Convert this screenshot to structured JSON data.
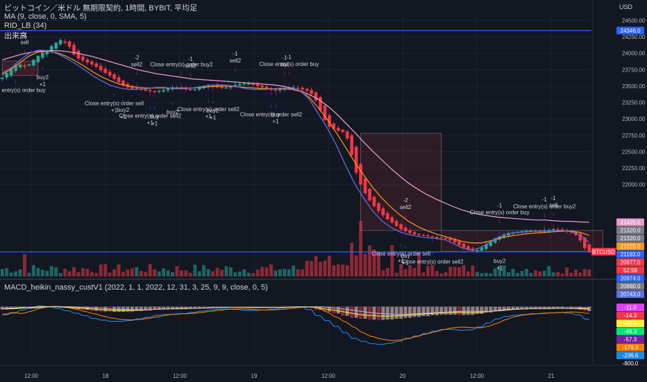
{
  "header": {
    "title": "ビットコイン／米ドル 無期限契約, 1時間, BYBIT, 平均足",
    "ma": "MA (9, close, 0, SMA, 5)",
    "rid": "RID_LB (34)",
    "volume": "出来高",
    "macd": "MACD_heikin_nassy_custV1 (2022, 1, 1, 2022, 12, 31, 3, 25, 9, 9, close, 0, 5)",
    "currency": "USD"
  },
  "colors": {
    "up": "#26a69a",
    "down": "#f23645",
    "ma_fast": "#5b6ee1",
    "ma_mid": "#f7931a",
    "ma_slow": "#e39ac9",
    "hline": "#2962ff",
    "buy": "#2962ff",
    "sell": "#f23645",
    "close": "#d500f9"
  },
  "chart_data": [
    {
      "type": "candlestick",
      "name": "price",
      "ylim": [
        20600,
        24600
      ],
      "y_ticks": [
        24500,
        24250,
        24000,
        23750,
        23500,
        23250,
        23000,
        22750,
        22500,
        22250,
        22000
      ],
      "x_ticks": [
        "12:00",
        "18",
        "12:00",
        "19",
        "12:00",
        "20",
        "12:00",
        "21"
      ],
      "hlines": [
        24346,
        20974
      ],
      "price_tags": [
        {
          "label": "24346.0",
          "value": 24346,
          "color": "#2962ff"
        },
        {
          "label": "21425.5",
          "value": 21425.5,
          "color": "#e39ac9"
        },
        {
          "label": "21320.0",
          "value": 21320,
          "color": "#787b86"
        },
        {
          "label": "21320.0",
          "value": 21320,
          "color": "#787b86"
        },
        {
          "label": "21225.0",
          "value": 21225,
          "color": "#f7931a"
        },
        {
          "label": "21193.0",
          "value": 21193,
          "color": "#2962ff"
        },
        {
          "label": "BTCUSD",
          "value": 20977,
          "color": "#f23645"
        },
        {
          "label": "20977.0",
          "value": 20977,
          "color": "#f23645"
        },
        {
          "label": "52:59",
          "value": 20977,
          "color": "#f23645"
        },
        {
          "label": "20974.0",
          "value": 20974,
          "color": "#2962ff"
        },
        {
          "label": "20880.0",
          "value": 20880,
          "color": "#787b86"
        },
        {
          "label": "20743.0",
          "value": 20743,
          "color": "#5b6ee1"
        }
      ],
      "close": [
        23630,
        23700,
        23760,
        23810,
        23830,
        23800,
        23830,
        23900,
        23960,
        24010,
        24030,
        24110,
        24160,
        24200,
        24160,
        24100,
        23980,
        23920,
        23890,
        23860,
        23830,
        23790,
        23740,
        23700,
        23660,
        23610,
        23560,
        23510,
        23480,
        23460,
        23460,
        23450,
        23430,
        23420,
        23410,
        23430,
        23440,
        23460,
        23480,
        23470,
        23460,
        23450,
        23440,
        23450,
        23480,
        23500,
        23520,
        23500,
        23480,
        23470,
        23480,
        23500,
        23520,
        23530,
        23540,
        23540,
        23520,
        23500,
        23480,
        23460,
        23440,
        23440,
        23450,
        23460,
        23470,
        23480,
        23470,
        23450,
        23430,
        23380,
        23280,
        23130,
        22980,
        22880,
        22850,
        22820,
        22800,
        22700,
        22450,
        22180,
        22000,
        21870,
        21760,
        21670,
        21600,
        21530,
        21470,
        21420,
        21370,
        21320,
        21290,
        21260,
        21240,
        21230,
        21220,
        21210,
        21200,
        21190,
        21180,
        21170,
        21150,
        21120,
        21080,
        21040,
        21010,
        20990,
        21000,
        21040,
        21090,
        21140,
        21180,
        21210,
        21240,
        21260,
        21270,
        21280,
        21290,
        21300,
        21300,
        21290,
        21280,
        21300,
        21310,
        21320,
        21310,
        21300,
        21290,
        21270,
        21230,
        21150,
        21030,
        20977
      ],
      "indicators": {
        "ma_fast": [
          23700,
          23780,
          23900,
          24000,
          24050,
          24040,
          24000,
          23930,
          23850,
          23760,
          23660,
          23580,
          23510,
          23470,
          23450,
          23450,
          23460,
          23480,
          23480,
          23460,
          23460,
          23470,
          23490,
          23510,
          23520,
          23510,
          23490,
          23460,
          23450,
          23450,
          23460,
          23470,
          23460,
          23430,
          23300,
          23080,
          22860,
          22600,
          22300,
          22020,
          21800,
          21600,
          21450,
          21350,
          21280,
          21240,
          21210,
          21190,
          21180,
          21160,
          21100,
          21030,
          21000,
          21040,
          21120,
          21200,
          21250,
          21270,
          21280,
          21290,
          21290,
          21300,
          21300,
          21280,
          21230,
          21120
        ],
        "ma_mid": [
          23680,
          23760,
          23860,
          23960,
          24020,
          24030,
          24010,
          23960,
          23890,
          23810,
          23720,
          23640,
          23580,
          23530,
          23500,
          23480,
          23470,
          23470,
          23470,
          23470,
          23470,
          23470,
          23480,
          23490,
          23500,
          23500,
          23490,
          23480,
          23470,
          23460,
          23460,
          23460,
          23450,
          23420,
          23330,
          23170,
          22990,
          22790,
          22570,
          22350,
          22150,
          21960,
          21800,
          21660,
          21540,
          21440,
          21360,
          21300,
          21250,
          21210,
          21170,
          21130,
          21110,
          21110,
          21140,
          21180,
          21210,
          21230,
          21250,
          21260,
          21270,
          21280,
          21290,
          21290,
          21270,
          21225
        ],
        "ma_slow": [
          23900,
          23940,
          23980,
          24010,
          24030,
          24040,
          24040,
          24030,
          24010,
          23980,
          23950,
          23910,
          23870,
          23830,
          23790,
          23750,
          23720,
          23690,
          23670,
          23650,
          23630,
          23610,
          23600,
          23590,
          23580,
          23570,
          23560,
          23550,
          23540,
          23530,
          23520,
          23500,
          23470,
          23430,
          23370,
          23300,
          23200,
          23080,
          22940,
          22800,
          22650,
          22510,
          22380,
          22250,
          22130,
          22020,
          21930,
          21850,
          21780,
          21720,
          21660,
          21610,
          21570,
          21540,
          21520,
          21500,
          21490,
          21480,
          21470,
          21460,
          21460,
          21450,
          21440,
          21440,
          21430,
          21425
        ]
      },
      "signals": [
        {
          "i": 3,
          "side": "buy",
          "lines": [
            "Close entry(s) order buy"
          ]
        },
        {
          "i": 5,
          "side": "sell",
          "lines": [
            "-1",
            "sell"
          ]
        },
        {
          "i": 9,
          "side": "buy",
          "lines": [
            "buy2",
            "+1"
          ]
        },
        {
          "i": 25,
          "side": "buy",
          "lines": [
            "Close entry(s) order sell",
            "+1"
          ]
        },
        {
          "i": 27,
          "side": "buy",
          "lines": [
            "buy2",
            "+1"
          ]
        },
        {
          "i": 30,
          "side": "sell",
          "lines": [
            "-2",
            "sell2"
          ]
        },
        {
          "i": 33,
          "side": "buy",
          "lines": [
            "Close entry(s) order sell2",
            "+1"
          ]
        },
        {
          "i": 34,
          "side": "buy",
          "lines": [
            "buy",
            "+1"
          ]
        },
        {
          "i": 38,
          "side": "buy",
          "lines": [
            "buy2"
          ]
        },
        {
          "i": 40,
          "side": "sell",
          "lines": [
            "Close entry(s) order buy2"
          ]
        },
        {
          "i": 42,
          "side": "sell",
          "lines": [
            "-1",
            "sell2"
          ]
        },
        {
          "i": 46,
          "side": "buy",
          "lines": [
            "Close entry(s) order sell2",
            "+1"
          ]
        },
        {
          "i": 47,
          "side": "buy",
          "lines": [
            "buy2",
            "+1"
          ]
        },
        {
          "i": 52,
          "side": "sell",
          "lines": [
            "-1",
            "sell2"
          ]
        },
        {
          "i": 60,
          "side": "buy",
          "lines": [
            "Close entry(s) order sell2"
          ]
        },
        {
          "i": 61,
          "side": "buy",
          "lines": [
            "buy",
            "+1"
          ]
        },
        {
          "i": 63,
          "side": "sell",
          "lines": [
            "-1",
            "sell"
          ]
        },
        {
          "i": 64,
          "side": "sell",
          "lines": [
            "-1",
            "Close entry(s) order buy"
          ]
        },
        {
          "i": 90,
          "side": "sell",
          "lines": [
            "-2",
            "sell2"
          ]
        },
        {
          "i": 89,
          "side": "buy",
          "lines": [
            "Close entry(s) order sell",
            "+1"
          ]
        },
        {
          "i": 90,
          "side": "buy",
          "lines": [
            "buy",
            "+1"
          ]
        },
        {
          "i": 96,
          "side": "buy",
          "lines": [
            "Close entry(s) order sell2"
          ]
        },
        {
          "i": 111,
          "side": "sell",
          "lines": [
            "-1",
            "Close entry(s) order buy"
          ]
        },
        {
          "i": 111,
          "side": "buy",
          "lines": [
            "buy2",
            "+1"
          ]
        },
        {
          "i": 121,
          "side": "sell",
          "lines": [
            "-1",
            "Close entry(s) order buy2"
          ]
        },
        {
          "i": 123,
          "side": "sell",
          "lines": [
            "-1",
            "sell"
          ]
        }
      ]
    },
    {
      "type": "bar",
      "name": "volume"
    },
    {
      "type": "line",
      "name": "macd",
      "ylim": [
        -820,
        260
      ],
      "tags": [
        {
          "label": "-11.0",
          "value": -11,
          "color": "#e040fb"
        },
        {
          "label": "-14.3",
          "value": -14.3,
          "color": "#f23645"
        },
        {
          "label": "-32.1",
          "value": -32.1,
          "color": "#ffeb3b"
        },
        {
          "label": "-46.3",
          "value": -46.3,
          "color": "#00e676"
        },
        {
          "label": "-57.3",
          "value": -57.3,
          "color": "#7b1fa2"
        },
        {
          "label": "-179.3",
          "value": -179.3,
          "color": "#f57c00"
        },
        {
          "label": "-236.6",
          "value": -236.6,
          "color": "#1e88e5"
        },
        {
          "label": "-800.0",
          "value": -800,
          "color": "none"
        }
      ]
    }
  ]
}
